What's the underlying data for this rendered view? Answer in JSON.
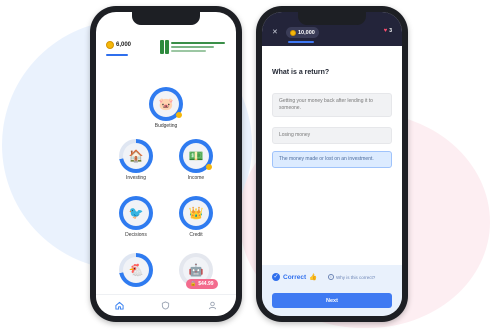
{
  "colors": {
    "accent": "#2f7bf0",
    "header_dark": "#23243a",
    "pink": "#f36b8d",
    "coin": "#f5b70a"
  },
  "left_screen": {
    "coins": "6,000",
    "partner_logo": {
      "icon": "university-logo-icon",
      "lines": [
        "Federation of Bosnia",
        "and Herzegovina",
        ""
      ]
    },
    "lessons": [
      {
        "label": "Budgeting",
        "icon": "piggy-bank-icon",
        "progress": 1.0
      },
      {
        "label": "Investing",
        "icon": "house-icon",
        "progress": 0.72
      },
      {
        "label": "Income",
        "icon": "cash-icon",
        "progress": 1.0
      },
      {
        "label": "Decisions",
        "icon": "bird-icon",
        "progress": 1.0
      },
      {
        "label": "Credit",
        "icon": "crown-icon",
        "progress": 1.0
      },
      {
        "label": "",
        "icon": "chicken-icon",
        "progress": 0.72
      },
      {
        "label": "",
        "icon": "robot-icon",
        "progress": 0.0
      }
    ],
    "unlock_pill": "$44.99",
    "tabbar": [
      "home-icon",
      "shield-icon",
      "profile-icon"
    ]
  },
  "right_screen": {
    "coins": "10,000",
    "hearts": "3",
    "question": "What is a return?",
    "options": [
      {
        "text": "Getting your money back after lending it to someone.",
        "selected": false
      },
      {
        "text": "Losing money",
        "selected": false
      },
      {
        "text": "The money made or lost on an investment.",
        "selected": true
      }
    ],
    "result": {
      "status": "Correct",
      "why_label": "Why is this correct?"
    },
    "next_button": "Next"
  }
}
